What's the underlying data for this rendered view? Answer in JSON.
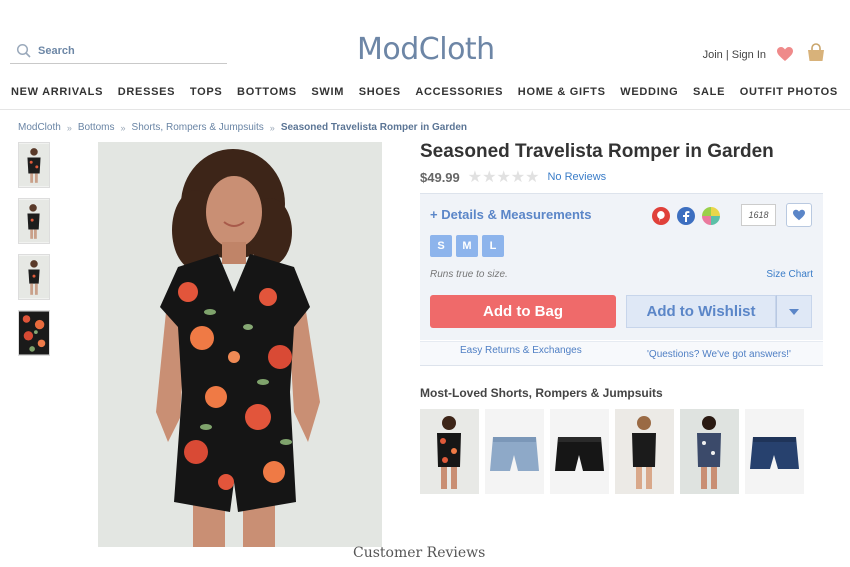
{
  "header": {
    "search_placeholder": "Search",
    "logo": "ModCloth",
    "join_signin": "Join | Sign In"
  },
  "nav": [
    "NEW ARRIVALS",
    "DRESSES",
    "TOPS",
    "BOTTOMS",
    "SWIM",
    "SHOES",
    "ACCESSORIES",
    "HOME & GIFTS",
    "WEDDING",
    "SALE",
    "OUTFIT PHOTOS"
  ],
  "breadcrumb": [
    "ModCloth",
    "Bottoms",
    "Shorts, Rompers & Jumpsuits",
    "Seasoned Travelista Romper in Garden"
  ],
  "product": {
    "title": "Seasoned Travelista Romper in Garden",
    "price": "$49.99",
    "stars": "★★★★★",
    "reviews_link": "No Reviews",
    "details_label": "+ Details & Measurements",
    "favorites_count": "1618",
    "sizes": [
      "S",
      "M",
      "L"
    ],
    "fit_note": "Runs true to size.",
    "size_chart": "Size Chart",
    "add_to_bag": "Add to Bag",
    "add_to_wishlist": "Add to Wishlist",
    "returns": "Easy Returns & Exchanges",
    "questions": "'Questions? We've got answers!'"
  },
  "related": {
    "heading": "Most-Loved Shorts, Rompers & Jumpsuits"
  },
  "reviews_heading": "Customer Reviews",
  "colors": {
    "brand_blue": "#6d86a6",
    "link_blue": "#3b7dc8",
    "add_to_bag": "#ef6a6a",
    "size_button": "#8db4ec",
    "heart": "#ef8a8a"
  }
}
